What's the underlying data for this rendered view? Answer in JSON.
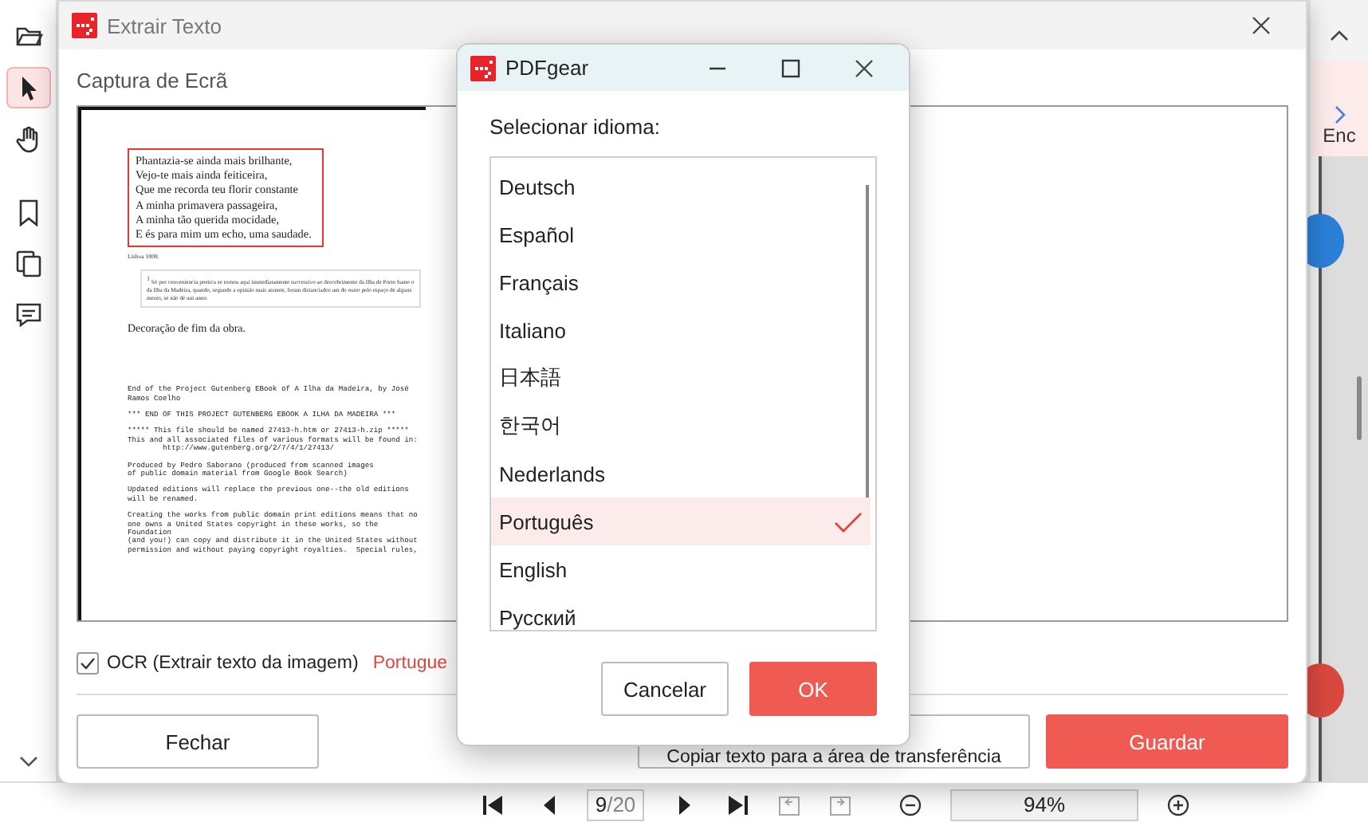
{
  "app": {
    "tools": [
      {
        "kind": "folder",
        "selected": false
      },
      {
        "kind": "pointer",
        "selected": true
      },
      {
        "kind": "hand",
        "selected": false
      },
      {
        "kind": "bookmark",
        "selected": false
      },
      {
        "kind": "pages",
        "selected": false
      },
      {
        "kind": "comment",
        "selected": false
      }
    ],
    "side_tab": {
      "label": "Enc"
    },
    "navigation": {
      "page_number": "9",
      "page_total": "/20",
      "zoom": "94%"
    }
  },
  "extract_dialog": {
    "title": "Extrair Texto",
    "section_label": "Captura de Ecrã",
    "preview": {
      "poem": [
        "Phantazia-se ainda mais brilhante,",
        "Vejo-te mais ainda feiticeira,",
        "Que me recorda teu florir constante",
        "A minha primavera passageira,",
        "A minha tão querida mocidade,",
        "E és para mim um echo, uma saudade."
      ],
      "place_date": "Lisboa 1808.",
      "footnote_mark": "1",
      "footnote": "Só por conveniencia poetica se tornou aqui immediatamente successivo ao descobrimento da Ilha de Porto Santo o da Ilha da Madeira, quando, segundo a opinião mais assente, foram distanciados um do outro pelo espaço de alguns mezes, se não de um anno.",
      "caption": "Decoração de fim da obra.",
      "plain_text": [
        [
          "End of the Project Gutenberg EBook of A Ilha da Madeira, by José",
          "Ramos Coelho"
        ],
        [
          "*** END OF THIS PROJECT GUTENBERG EBOOK A ILHA DA MADEIRA ***"
        ],
        [
          "***** This file should be named 27413-h.htm or 27413-h.zip *****",
          "This and all associated files of various formats will be found in:",
          "        http://www.gutenberg.org/2/7/4/1/27413/"
        ],
        [
          "Produced by Pedro Saborano (produced from scanned images",
          "of public domain material from Google Book Search)"
        ],
        [
          "Updated editions will replace the previous one--the old editions",
          "will be renamed."
        ],
        [
          "Creating the works from public domain print editions means that no",
          "one owns a United States copyright in these works, so the",
          "Foundation",
          "(and you!) can copy and distribute it in the United States without",
          "permission and without paying copyright royalties.  Special rules,"
        ]
      ]
    },
    "ocr": {
      "label": "OCR (Extrair texto da imagem)",
      "checked": true
    },
    "language": "Portugue",
    "buttons": [
      {
        "label": "Fechar",
        "kind": "default"
      },
      {
        "label": "Copiar texto para a área de transferência",
        "kind": "default"
      },
      {
        "label": "Guardar",
        "kind": "primary"
      }
    ]
  },
  "language_dialog": {
    "title": "PDFgear",
    "prompt": "Selecionar idioma:",
    "languages": [
      {
        "label": "Deutsch",
        "selected": false
      },
      {
        "label": "Español",
        "selected": false
      },
      {
        "label": "Français",
        "selected": false
      },
      {
        "label": "Italiano",
        "selected": false
      },
      {
        "label": "日本語",
        "selected": false
      },
      {
        "label": "한국어",
        "selected": false
      },
      {
        "label": "Nederlands",
        "selected": false
      },
      {
        "label": "Português",
        "selected": true
      },
      {
        "label": "English",
        "selected": false
      },
      {
        "label": "Русский",
        "selected": false
      }
    ],
    "buttons": [
      {
        "label": "Cancelar",
        "kind": "default"
      },
      {
        "label": "OK",
        "kind": "primary"
      }
    ]
  }
}
